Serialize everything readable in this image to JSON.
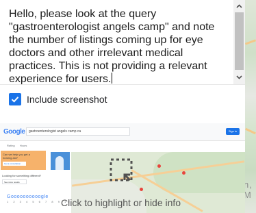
{
  "feedback": {
    "text": "Hello, please look at the query \"gastroenterologist angels camp\" and note the number of listings coming up for eye doctors and other irrelevant medical practices. This is not providing a relevant experience for users."
  },
  "scrollbar": {
    "up_icon": "chevron-up-icon",
    "down_icon": "chevron-down-icon"
  },
  "include_screenshot": {
    "label": "Include screenshot",
    "checked": true
  },
  "preview": {
    "logo": "Google",
    "search_query": "gastroenterologist angels camp ca",
    "sign_in": "Sign in",
    "tabs": [
      "Rating",
      "Hours"
    ],
    "ad_text": "Can we help you get a hearing aid?",
    "ad_button": "Get a consultation",
    "looking_text": "Looking for something different?",
    "looking_button": "See more results",
    "footer_logo": "Goooooooooogle",
    "footer_sub": "1 2 3 4 5 6 7 8 9 10",
    "hint": "Click to highlight or hide info"
  },
  "background": {
    "map_letters": "n, M"
  },
  "colors": {
    "accent": "#1a73e8",
    "text": "#1a1a1a",
    "hint": "#555555"
  }
}
